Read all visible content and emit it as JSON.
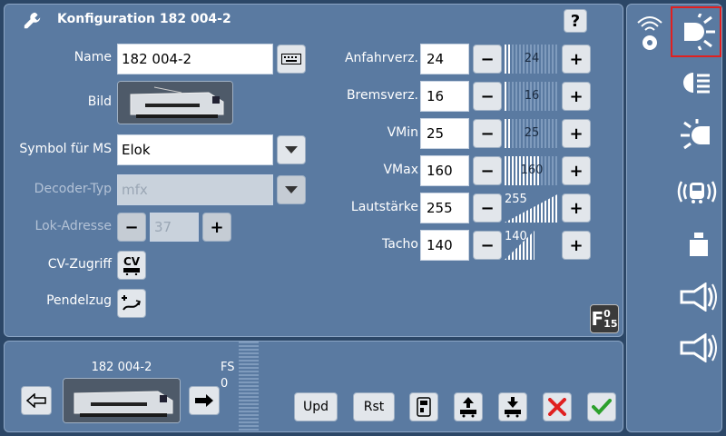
{
  "header": {
    "title": "Konfiguration 182 004-2",
    "help_label": "?"
  },
  "form": {
    "name_label": "Name",
    "name_value": "182 004-2",
    "bild_label": "Bild",
    "symbol_label": "Symbol für MS",
    "symbol_value": "Elok",
    "decoder_label": "Decoder-Typ",
    "decoder_value": "mfx",
    "adresse_label": "Lok-Adresse",
    "adresse_value": "37",
    "cv_label": "CV-Zugriff",
    "cv_button": "CV",
    "pendel_label": "Pendelzug"
  },
  "params": [
    {
      "label": "Anfahrverz.",
      "value": "24",
      "slider_text": "24",
      "fraction": 0.094
    },
    {
      "label": "Bremsverz.",
      "value": "16",
      "slider_text": "16",
      "fraction": 0.063
    },
    {
      "label": "VMin",
      "value": "25",
      "slider_text": "25",
      "fraction": 0.098
    },
    {
      "label": "VMax",
      "value": "160",
      "slider_text": "160",
      "fraction": 0.627
    },
    {
      "label": "Lautstärke",
      "value": "255",
      "slider_text": "255",
      "fraction": 1.0
    },
    {
      "label": "Tacho",
      "value": "140",
      "slider_text": "140",
      "fraction": 0.549
    }
  ],
  "f_button": {
    "letter": "F",
    "top": "0",
    "bottom": "15"
  },
  "bottom": {
    "loco_name": "182 004-2",
    "fs_label": "FS",
    "fs_value": "0",
    "upd_label": "Upd",
    "rst_label": "Rst"
  },
  "sidebar": {
    "icons": [
      "radio-signal-icon",
      "front-light-icon",
      "headlight-beam-icon",
      "rear-light-icon",
      "train-sound-icon",
      "weight-icon",
      "horn-icon",
      "horn-2-icon"
    ],
    "selected": "front-light-icon"
  },
  "colors": {
    "panel": "#5a7aa1",
    "background": "#2c4767",
    "selection": "#e02020",
    "confirm": "#2ca02c",
    "cancel": "#e02020"
  }
}
